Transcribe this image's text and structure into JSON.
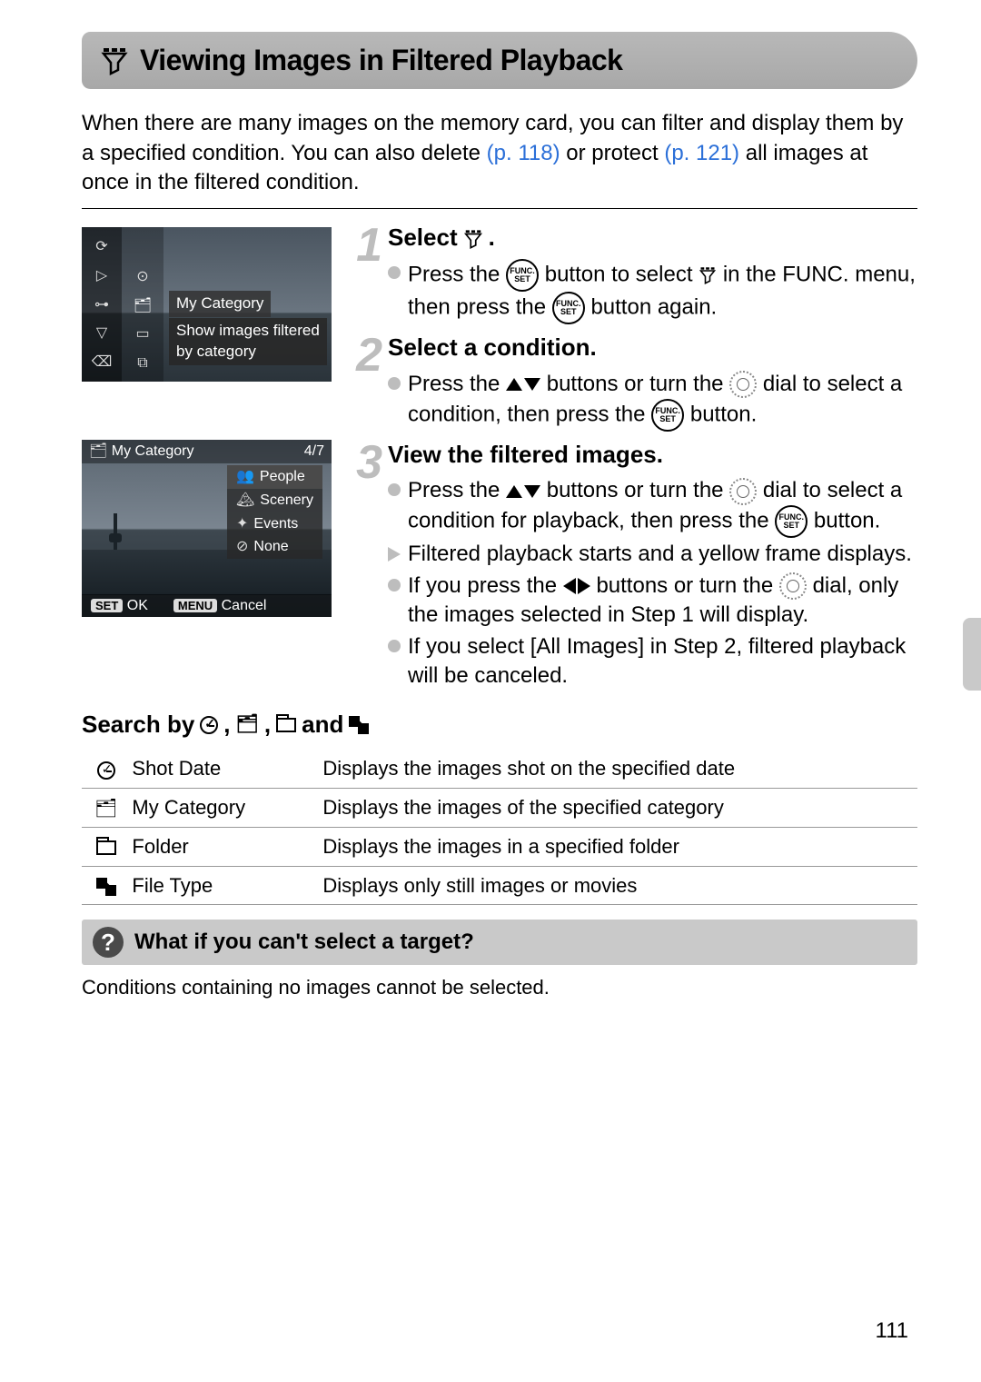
{
  "header": {
    "title": "Viewing Images in Filtered Playback"
  },
  "intro": {
    "part1": "When there are many images on the memory card, you can filter and display them by a specified condition. You can also delete ",
    "link1": "(p. 118)",
    "part2": " or protect ",
    "link2": "(p. 121)",
    "part3": " all images at once in the filtered condition."
  },
  "screenshot1": {
    "label": "My Category",
    "desc_line1": "Show images filtered",
    "desc_line2": "by category"
  },
  "screenshot2": {
    "title": "My Category",
    "counter": "4/7",
    "options": [
      "People",
      "Scenery",
      "Events",
      "None"
    ],
    "set_label": "SET",
    "ok_label": "OK",
    "menu_label": "MENU",
    "cancel_label": "Cancel"
  },
  "steps": [
    {
      "num": "1",
      "title_pre": "Select ",
      "title_post": ".",
      "lines": [
        {
          "t": "dot",
          "pre": "Press the ",
          "post1": " button to select ",
          "post2": " in the FUNC. menu, then press the ",
          "post3": " button again."
        }
      ]
    },
    {
      "num": "2",
      "title": "Select a condition.",
      "lines": [
        {
          "t": "dot",
          "pre": "Press the ",
          "mid1": " buttons or turn the ",
          "mid2": " dial to select a condition, then press the ",
          "post": " button."
        }
      ]
    },
    {
      "num": "3",
      "title": "View the filtered images.",
      "lines": [
        {
          "t": "dot",
          "pre": "Press the ",
          "mid1": " buttons or turn the ",
          "mid2": " dial to select a condition for playback, then press the ",
          "post": " button."
        },
        {
          "t": "tri",
          "text": "Filtered playback starts and a yellow frame displays."
        },
        {
          "t": "dot",
          "pre": "If you press the ",
          "mid1": " buttons or turn the ",
          "mid2": " dial, only the images selected in Step 1 will display."
        },
        {
          "t": "dot",
          "text": "If you select [All Images] in Step 2, filtered playback will be canceled."
        }
      ]
    }
  ],
  "search_by": {
    "title_pre": "Search by ",
    "comma": ", ",
    "and": " and ",
    "rows": [
      {
        "name": "Shot Date",
        "desc": "Displays the images shot on the specified date"
      },
      {
        "name": "My Category",
        "desc": "Displays the images of the specified category"
      },
      {
        "name": "Folder",
        "desc": "Displays the images in a specified folder"
      },
      {
        "name": "File Type",
        "desc": "Displays only still images or movies"
      }
    ]
  },
  "tip": {
    "title": "What if you can't select a target?",
    "body": "Conditions containing no images cannot be selected."
  },
  "page_number": "111",
  "labels": {
    "func": "FUNC.",
    "set": "SET"
  }
}
